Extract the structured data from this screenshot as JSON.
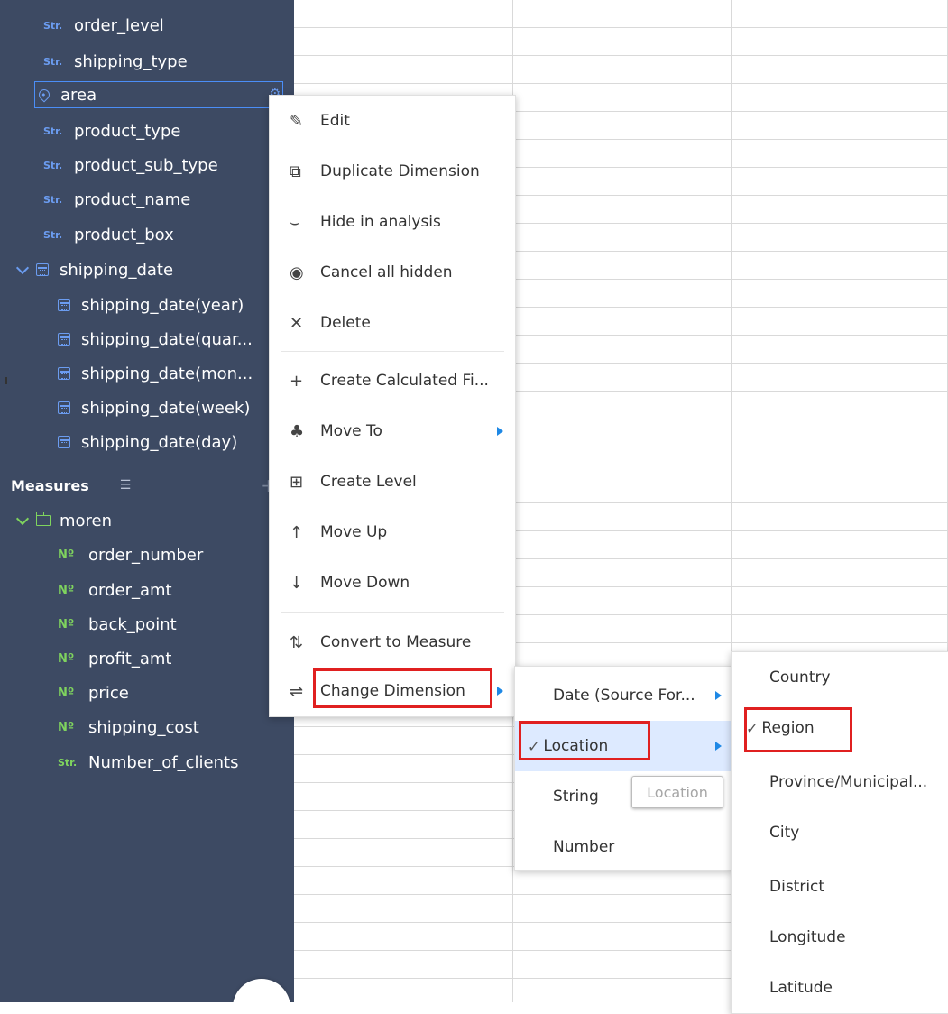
{
  "sidebar": {
    "dimensions": [
      {
        "tag": "Str.",
        "label": "order_level"
      },
      {
        "tag": "Str.",
        "label": "shipping_type"
      },
      {
        "tag": "pin",
        "label": "area"
      },
      {
        "tag": "Str.",
        "label": "product_type"
      },
      {
        "tag": "Str.",
        "label": "product_sub_type"
      },
      {
        "tag": "Str.",
        "label": "product_name"
      },
      {
        "tag": "Str.",
        "label": "product_box"
      }
    ],
    "date_group": {
      "label": "shipping_date",
      "children": [
        "shipping_date(year)",
        "shipping_date(quar...",
        "shipping_date(mon...",
        "shipping_date(week)",
        "shipping_date(day)"
      ]
    },
    "measures_title": "Measures",
    "measures_folder": "moren",
    "measures": [
      {
        "tag": "Nº",
        "label": "order_number"
      },
      {
        "tag": "Nº",
        "label": "order_amt"
      },
      {
        "tag": "Nº",
        "label": "back_point"
      },
      {
        "tag": "Nº",
        "label": "profit_amt"
      },
      {
        "tag": "Nº",
        "label": "price"
      },
      {
        "tag": "Nº",
        "label": "shipping_cost"
      },
      {
        "tag": "Str.",
        "label": "Number_of_clients"
      }
    ]
  },
  "context_menu": {
    "items": [
      {
        "icon": "pencil-icon",
        "label": "Edit"
      },
      {
        "icon": "duplicate-icon",
        "label": "Duplicate Dimension"
      },
      {
        "icon": "eye-closed-icon",
        "label": "Hide in analysis"
      },
      {
        "icon": "eye-icon",
        "label": "Cancel all hidden"
      },
      {
        "icon": "close-icon",
        "label": "Delete"
      },
      {
        "icon": "plus-icon",
        "label": "Create Calculated Fi..."
      },
      {
        "icon": "move-to-icon",
        "label": "Move To"
      },
      {
        "icon": "create-level-icon",
        "label": "Create Level"
      },
      {
        "icon": "arrow-up-icon",
        "label": "Move Up"
      },
      {
        "icon": "arrow-down-icon",
        "label": "Move Down"
      },
      {
        "icon": "convert-icon",
        "label": "Convert to Measure"
      },
      {
        "icon": "swap-icon",
        "label": "Change Dimension"
      }
    ]
  },
  "submenu_type": {
    "items": [
      "Date (Source For...",
      "Location",
      "String",
      "Number"
    ],
    "selected": "Location"
  },
  "tooltip": "Location",
  "submenu_location": {
    "items": [
      "Country",
      "Region",
      "Province/Municipal...",
      "City",
      "District",
      "Longitude",
      "Latitude"
    ],
    "selected": "Region"
  },
  "colors": {
    "sidebar_bg": "#3d4a63",
    "accent_blue": "#4b8ef7",
    "tag_green": "#7fd45e",
    "highlight_red": "#e02020",
    "selected_bg": "#ddeaff"
  }
}
